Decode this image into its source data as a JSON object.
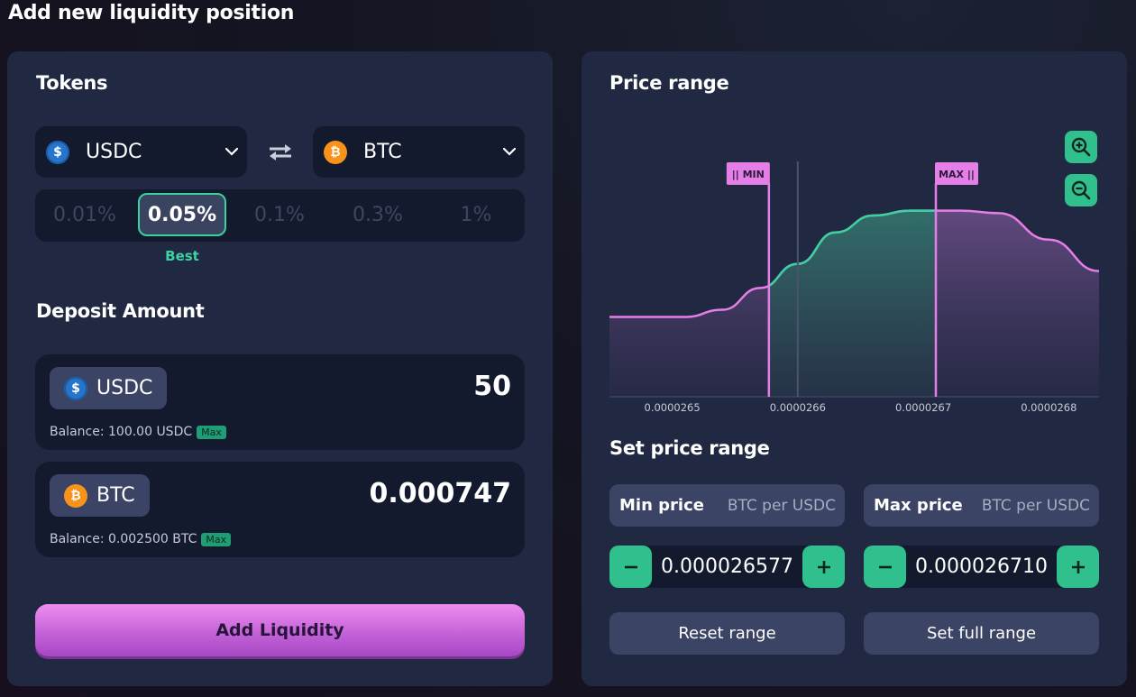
{
  "page_title": "Add new liquidity position",
  "tokens_section": {
    "title": "Tokens",
    "token_a": {
      "symbol": "USDC",
      "icon": "usdc-coin-icon"
    },
    "token_b": {
      "symbol": "BTC",
      "icon": "btc-coin-icon"
    },
    "fee_tiers": [
      {
        "label": "0.01%",
        "selected": false
      },
      {
        "label": "0.05%",
        "selected": true
      },
      {
        "label": "0.1%",
        "selected": false
      },
      {
        "label": "0.3%",
        "selected": false
      },
      {
        "label": "1%",
        "selected": false
      }
    ],
    "best_label": "Best"
  },
  "deposit_section": {
    "title": "Deposit Amount",
    "items": [
      {
        "symbol": "USDC",
        "amount": "50",
        "balance": "Balance: 100.00 USDC",
        "max_label": "Max"
      },
      {
        "symbol": "BTC",
        "amount": "0.000747",
        "balance": "Balance: 0.002500 BTC",
        "max_label": "Max"
      }
    ]
  },
  "add_button_label": "Add Liquidity",
  "price_range": {
    "title": "Price range",
    "min_marker": "MIN",
    "max_marker": "MAX",
    "current_price": 2.66e-05,
    "x_range": [
      2.645e-05,
      2.684e-05
    ],
    "x_ticks": [
      "0.0000265",
      "0.0000266",
      "0.0000267",
      "0.0000268"
    ],
    "liquidity_curve": [
      [
        2.645e-05,
        0.33
      ],
      [
        2.651e-05,
        0.33
      ],
      [
        2.654e-05,
        0.36
      ],
      [
        2.657e-05,
        0.45
      ],
      [
        2.66e-05,
        0.55
      ],
      [
        2.663e-05,
        0.68
      ],
      [
        2.666e-05,
        0.75
      ],
      [
        2.669e-05,
        0.77
      ],
      [
        2.673e-05,
        0.77
      ],
      [
        2.676e-05,
        0.76
      ],
      [
        2.68e-05,
        0.65
      ],
      [
        2.684e-05,
        0.52
      ]
    ],
    "colors": {
      "in_range": "#3ad29f",
      "out_range": "#e67ee8",
      "marker": "#e67ee8"
    },
    "zoom_in_icon": "zoom-in-icon",
    "zoom_out_icon": "zoom-out-icon"
  },
  "set_price_range": {
    "title": "Set price range",
    "min": {
      "label": "Min price",
      "unit": "BTC per USDC",
      "value": "0.000026577"
    },
    "max": {
      "label": "Max price",
      "unit": "BTC per USDC",
      "value": "0.000026710"
    },
    "reset_label": "Reset range",
    "full_label": "Set full range"
  }
}
